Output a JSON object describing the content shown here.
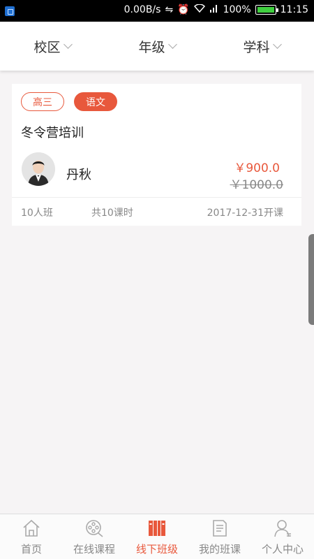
{
  "status_bar": {
    "net_speed": "0.00B/s",
    "battery_pct": "100%",
    "time": "11:15"
  },
  "filters": [
    {
      "label": "校区"
    },
    {
      "label": "年级"
    },
    {
      "label": "学科"
    }
  ],
  "course": {
    "tags": [
      "高三",
      "语文"
    ],
    "title": "冬令营培训",
    "teacher": "丹秋",
    "price": "￥900.0",
    "original_price": "￥1000.0",
    "class_size": "10人班",
    "lessons": "共10课时",
    "start_date": "2017-12-31开课"
  },
  "nav": [
    {
      "label": "首页",
      "icon": "home-icon"
    },
    {
      "label": "在线课程",
      "icon": "film-reel-icon"
    },
    {
      "label": "线下班级",
      "icon": "books-icon",
      "active": true
    },
    {
      "label": "我的班课",
      "icon": "document-icon"
    },
    {
      "label": "个人中心",
      "icon": "user-icon"
    }
  ],
  "colors": {
    "accent": "#e8583c",
    "page_bg": "#f6f4f5"
  }
}
